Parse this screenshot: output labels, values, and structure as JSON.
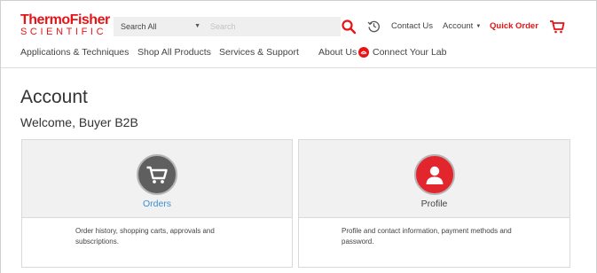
{
  "header": {
    "logo_line1": "ThermoFisher",
    "logo_line2": "SCIENTIFIC",
    "search_category": "Search All",
    "search_placeholder": "Search",
    "contact_label": "Contact Us",
    "account_label": "Account",
    "quick_order_label": "Quick Order"
  },
  "nav": {
    "items": [
      {
        "label": "Applications & Techniques"
      },
      {
        "label": "Shop All Products"
      },
      {
        "label": "Services & Support"
      },
      {
        "label": "About Us"
      },
      {
        "label": "Connect Your Lab",
        "icon": "connect-lab-icon"
      }
    ]
  },
  "page": {
    "title": "Account",
    "welcome": "Welcome, Buyer B2B"
  },
  "cards": [
    {
      "title": "Orders",
      "icon": "cart-icon",
      "description": "Order history, shopping carts, approvals and subscriptions."
    },
    {
      "title": "Profile",
      "icon": "user-icon",
      "description": "Profile and contact information, payment methods and password."
    }
  ],
  "colors": {
    "brand_red": "#e71316",
    "link_blue": "#3f8fd0",
    "card_background": "#f1f1f1"
  }
}
